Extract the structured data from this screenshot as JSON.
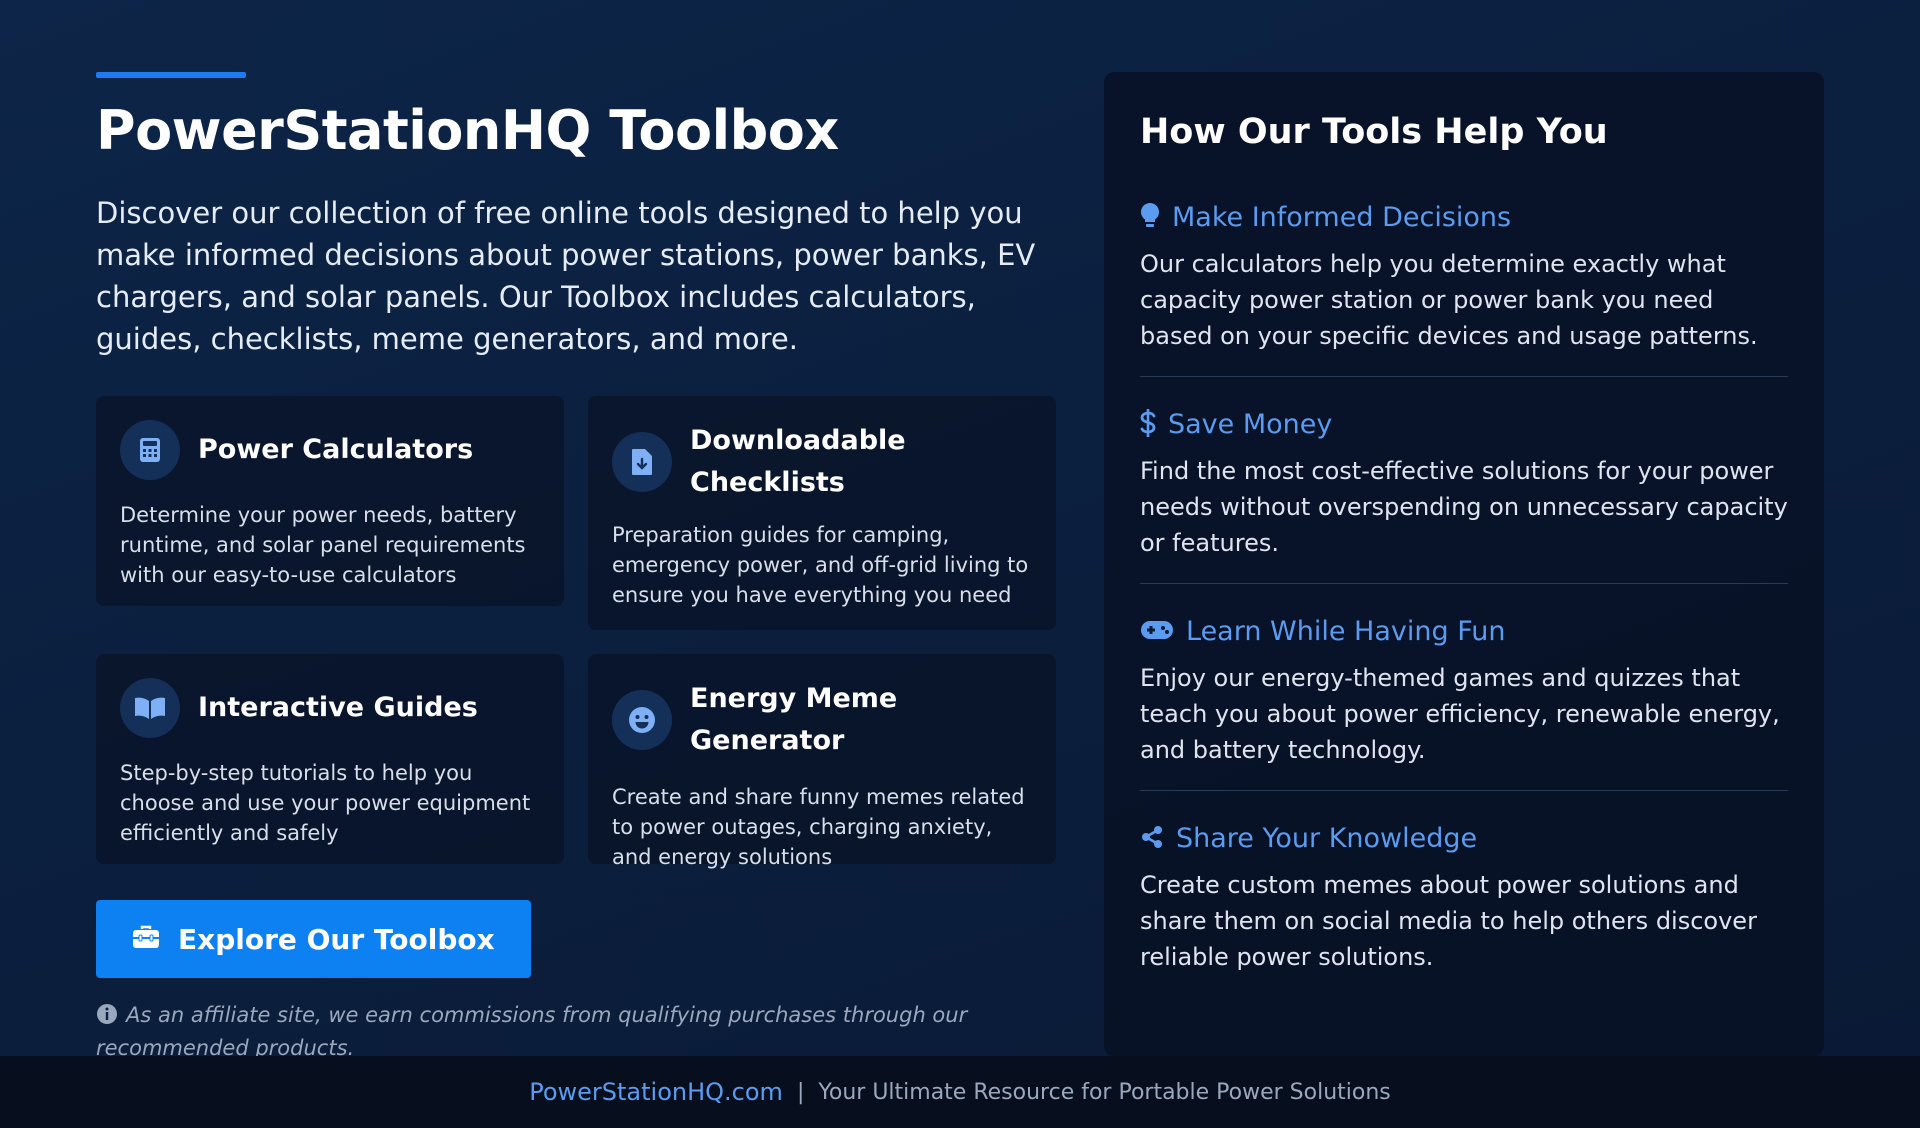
{
  "hero": {
    "title": "PowerStationHQ Toolbox",
    "intro": "Discover our collection of free online tools designed to help you make informed decisions about power stations, power banks, EV chargers, and solar panels. Our Toolbox includes calculators, guides, checklists, meme generators, and more."
  },
  "cards": [
    {
      "icon": "calculator-icon",
      "title": "Power Calculators",
      "desc": "Determine your power needs, battery runtime, and solar panel requirements with our easy-to-use calculators"
    },
    {
      "icon": "file-download-icon",
      "title": "Downloadable Checklists",
      "desc": "Preparation guides for camping, emergency power, and off-grid living to ensure you have everything you need"
    },
    {
      "icon": "book-open-icon",
      "title": "Interactive Guides",
      "desc": "Step-by-step tutorials to help you choose and use your power equipment efficiently and safely"
    },
    {
      "icon": "smile-icon",
      "title": "Energy Meme Generator",
      "desc": "Create and share funny memes related to power outages, charging anxiety, and energy solutions"
    }
  ],
  "cta": {
    "icon": "toolbox-icon",
    "label": "Explore Our Toolbox"
  },
  "disclaimer": {
    "icon": "info-icon",
    "text": "As an affiliate site, we earn commissions from qualifying purchases through our recommended products."
  },
  "benefits": {
    "title": "How Our Tools Help You",
    "items": [
      {
        "icon": "lightbulb-icon",
        "title": "Make Informed Decisions",
        "desc": "Our calculators help you determine exactly what capacity power station or power bank you need based on your specific devices and usage patterns."
      },
      {
        "icon": "dollar-icon",
        "title": "Save Money",
        "desc": "Find the most cost-effective solutions for your power needs without overspending on unnecessary capacity or features."
      },
      {
        "icon": "gamepad-icon",
        "title": "Learn While Having Fun",
        "desc": "Enjoy our energy-themed games and quizzes that teach you about power efficiency, renewable energy, and battery technology."
      },
      {
        "icon": "share-icon",
        "title": "Share Your Knowledge",
        "desc": "Create custom memes about power solutions and share them on social media to help others discover reliable power solutions."
      }
    ]
  },
  "footer": {
    "brand": "PowerStationHQ.com",
    "separator": "|",
    "tagline": "Your Ultimate Resource for Portable Power Solutions"
  },
  "colors": {
    "accent": "#1f7bf2",
    "cta": "#0d80f2",
    "link": "#5b9bf0",
    "icon": "#7fb0f5"
  }
}
